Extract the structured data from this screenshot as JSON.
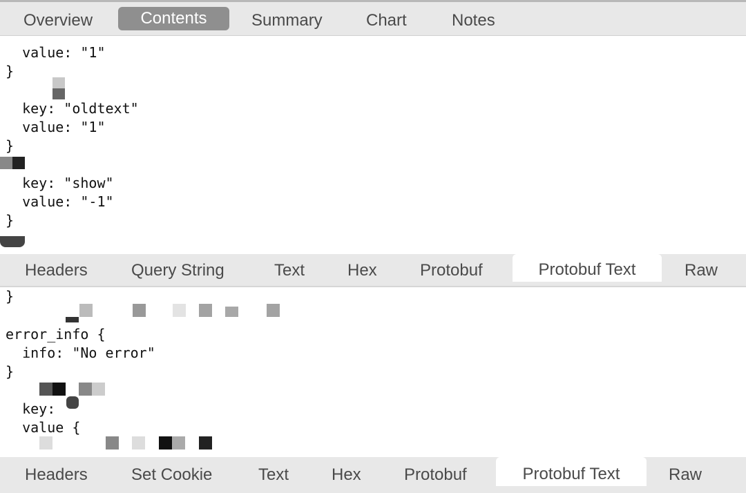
{
  "top_tabs": [
    {
      "label": "Overview"
    },
    {
      "label": "Contents",
      "selected": true
    },
    {
      "label": "Summary"
    },
    {
      "label": "Chart"
    },
    {
      "label": "Notes"
    }
  ],
  "request_pane": {
    "lines": [
      "  value: \"1\"",
      "}",
      "  key: \"oldtext\"",
      "  value: \"1\"",
      "}",
      "  key: \"show\"",
      "  value: \"-1\"",
      "}"
    ]
  },
  "request_tabs": [
    {
      "label": "Headers"
    },
    {
      "label": "Query String"
    },
    {
      "label": "Text"
    },
    {
      "label": "Hex"
    },
    {
      "label": "Protobuf"
    },
    {
      "label": "Protobuf Text",
      "selected": true
    },
    {
      "label": "Raw"
    }
  ],
  "response_pane": {
    "lines": [
      "}",
      "error_info {",
      "  info: \"No error\"",
      "}",
      "  key:",
      "  value {"
    ]
  },
  "response_tabs": [
    {
      "label": "Headers"
    },
    {
      "label": "Set Cookie"
    },
    {
      "label": "Text"
    },
    {
      "label": "Hex"
    },
    {
      "label": "Protobuf"
    },
    {
      "label": "Protobuf Text",
      "selected": true
    },
    {
      "label": "Raw"
    }
  ],
  "colors": {
    "tab_bar": "#e8e8e8",
    "selected_pill": "#8f8f8f",
    "text": "#111111"
  }
}
